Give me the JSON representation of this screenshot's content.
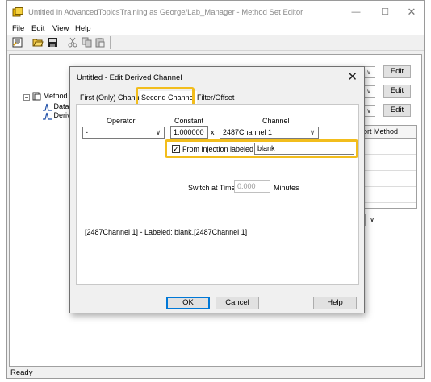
{
  "window": {
    "title": "Untitled in AdvancedTopicsTraining as George/Lab_Manager - Method Set Editor",
    "minimize_glyph": "—",
    "maximize_glyph": "☐",
    "close_glyph": "✕"
  },
  "menu": [
    "File",
    "Edit",
    "View",
    "Help"
  ],
  "toolbar": [
    "new-icon",
    "open-folder-icon",
    "save-icon",
    "cut-icon",
    "copy-icon",
    "paste-icon"
  ],
  "tree": {
    "root_label": "Method S",
    "children": [
      "Data",
      "Deriv"
    ],
    "collapse_glyph": "−"
  },
  "background_panel": {
    "edit_labels": [
      "Edit",
      "Edit",
      "Edit"
    ],
    "table_header": "ort Method",
    "combo_arrow": "∨"
  },
  "dialog": {
    "title": "Untitled - Edit Derived Channel",
    "close_glyph": "✕",
    "tabs": [
      {
        "label": "First (Only) Channel",
        "active": false
      },
      {
        "label": "Second Channel",
        "active": true
      },
      {
        "label": "Filter/Offset",
        "active": false
      }
    ],
    "operator": {
      "label": "Operator",
      "value": "-"
    },
    "constant": {
      "label": "Constant",
      "value": "1.000000"
    },
    "multiply_symbol": "x",
    "channel": {
      "label": "Channel",
      "value": "2487Channel 1"
    },
    "from_injection": {
      "label": "From injection labeled",
      "checked": true,
      "value": "blank"
    },
    "switch_at_time": {
      "label": "Switch at Time",
      "value": "0.000",
      "unit": "Minutes"
    },
    "summary": "[2487Channel 1] - Labeled: blank.[2487Channel 1]",
    "buttons": {
      "ok": "OK",
      "cancel": "Cancel",
      "help": "Help"
    },
    "combo_arrow": "∨",
    "check_glyph": "✓"
  },
  "status_bar": {
    "text": "Ready"
  },
  "colors": {
    "highlight": "#f2bd1c",
    "default_button_border": "#0078d7"
  }
}
